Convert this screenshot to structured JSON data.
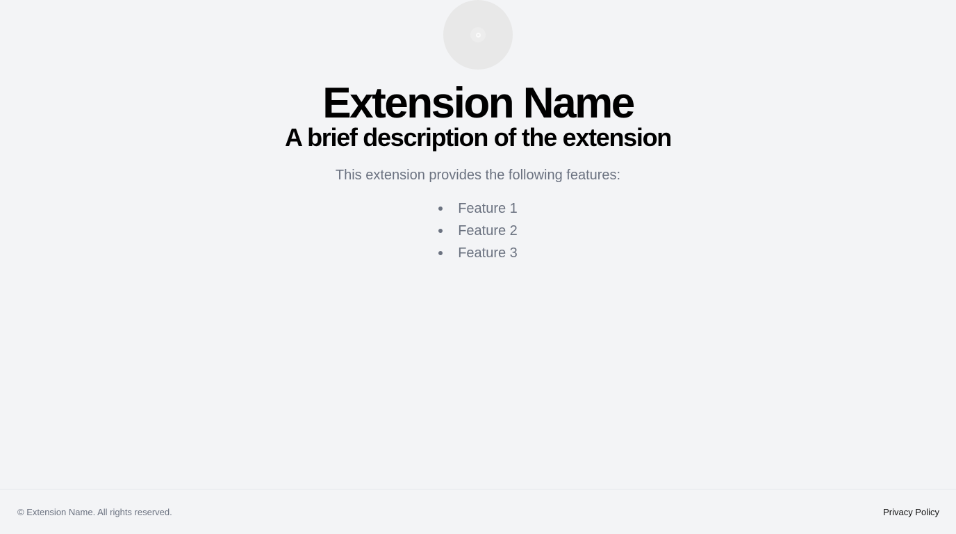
{
  "hero": {
    "logo_icon": "extension-logo-placeholder",
    "title": "Extension Name",
    "subtitle": "A brief description of the extension",
    "intro": "This extension provides the following features:",
    "features": [
      "Feature 1",
      "Feature 2",
      "Feature 3"
    ]
  },
  "footer": {
    "copyright": "© Extension Name. All rights reserved.",
    "privacy_link": "Privacy Policy"
  },
  "colors": {
    "background": "#f3f4f6",
    "heading": "#000000",
    "muted_text": "#6b7280",
    "footer_border": "#e5e7eb"
  }
}
